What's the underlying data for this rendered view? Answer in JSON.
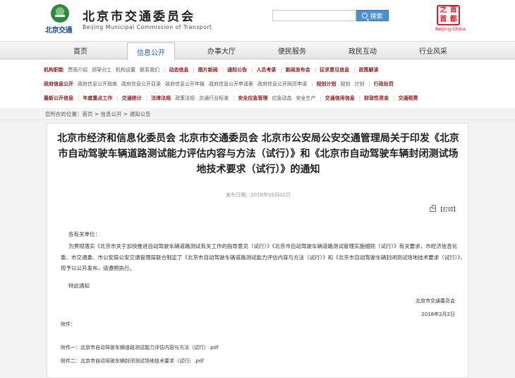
{
  "header": {
    "logo_sub": "北京交通",
    "title": "北京市交通委员会",
    "subtitle": "Beijing Municipal Commission of Transport",
    "search_placeholder": "",
    "search_button": "搜索",
    "seal_chars": [
      "之",
      "首",
      "首",
      "都"
    ],
    "seal_sub": "Beijing·China"
  },
  "mainnav": [
    {
      "label": "首页",
      "active": false
    },
    {
      "label": "信息公开",
      "active": true
    },
    {
      "label": "办事大厅",
      "active": false
    },
    {
      "label": "便民服务",
      "active": false
    },
    {
      "label": "政民互动",
      "active": false
    },
    {
      "label": "行业风采",
      "active": false
    }
  ],
  "subnav": {
    "row1": [
      {
        "t": "机构职能",
        "k": "sec"
      },
      {
        "t": "贾雨介绍",
        "k": "lnk"
      },
      {
        "t": "领导分工",
        "k": "lnk"
      },
      {
        "t": "机构设置",
        "k": "lnk"
      },
      {
        "t": "联系我们",
        "k": "lnk"
      },
      {
        "t": "|",
        "k": "sep"
      },
      {
        "t": "动态信息",
        "k": "sec"
      },
      {
        "t": "|",
        "k": "sep"
      },
      {
        "t": "图片新闻",
        "k": "sec"
      },
      {
        "t": "|",
        "k": "sep"
      },
      {
        "t": "通知公告",
        "k": "sec"
      },
      {
        "t": "|",
        "k": "sep"
      },
      {
        "t": "人员考录",
        "k": "sec"
      },
      {
        "t": "|",
        "k": "sep"
      },
      {
        "t": "新闻发布会",
        "k": "sec"
      },
      {
        "t": "|",
        "k": "sep"
      },
      {
        "t": "征求意见信息",
        "k": "sec"
      },
      {
        "t": "|",
        "k": "sep"
      },
      {
        "t": "政策解读",
        "k": "sec"
      }
    ],
    "row2": [
      {
        "t": "政府信息公开",
        "k": "sec"
      },
      {
        "t": "政府信息公开指南",
        "k": "lnk"
      },
      {
        "t": "政府信息公开目录",
        "k": "lnk"
      },
      {
        "t": "政府信息公开年报",
        "k": "lnk"
      },
      {
        "t": "政府信息公开申请表",
        "k": "lnk"
      },
      {
        "t": "政府信息公开网页申请",
        "k": "lnk"
      },
      {
        "t": "|",
        "k": "sep"
      },
      {
        "t": "规划计划",
        "k": "sec"
      },
      {
        "t": "规划",
        "k": "lnk"
      },
      {
        "t": "计划",
        "k": "lnk"
      },
      {
        "t": "|",
        "k": "sep"
      },
      {
        "t": "行政处罚",
        "k": "sec"
      }
    ],
    "row3": [
      {
        "t": "最新公开信息",
        "k": "sec"
      },
      {
        "t": "|",
        "k": "sep"
      },
      {
        "t": "年度重点工作",
        "k": "sec"
      },
      {
        "t": "|",
        "k": "sep"
      },
      {
        "t": "交通统计",
        "k": "sec"
      },
      {
        "t": "|",
        "k": "sep"
      },
      {
        "t": "法律法规",
        "k": "sec"
      },
      {
        "t": "政策法规",
        "k": "lnk"
      },
      {
        "t": "交通行业标准",
        "k": "lnk"
      },
      {
        "t": "|",
        "k": "sep"
      },
      {
        "t": "安全应急管理",
        "k": "sec"
      },
      {
        "t": "应急动态",
        "k": "lnk"
      },
      {
        "t": "安全生产",
        "k": "lnk"
      },
      {
        "t": "|",
        "k": "sep"
      },
      {
        "t": "交通信用信息",
        "k": "sec"
      },
      {
        "t": "|",
        "k": "sep"
      },
      {
        "t": "财政性资金",
        "k": "sec"
      },
      {
        "t": "|",
        "k": "sep"
      },
      {
        "t": "交通税费",
        "k": "sec"
      }
    ]
  },
  "breadcrumb": {
    "prefix": "您所在的位置：",
    "path": "首页 > 信息公开 > 通知公告"
  },
  "article": {
    "title": "北京市经济和信息化委员会 北京市交通委员会 北京市公安局公安交通管理局关于印发《北京市自动驾驶车辆道路测试能力评估内容与方法（试行）》和《北京市自动驾驶车辆封闭测试场地技术要求（试行）》的通知",
    "date": "发布日期：2018年02月02日",
    "print_label": "【打印】",
    "salutation": "各有关单位：",
    "paragraph": "为贯彻落实《北京市关于加快推进自动驾驶车辆道路测试有关工作的指导意见（试行）》《北京市自动驾驶车辆道路测试管理实施细则（试行）》有关要求，市经济信息化委、市交通委、市公安局公安交通管理局联合制定了《北京市自动驾驶车辆道路测试能力评估内容与方法（试行）》和《北京市自动驾驶车辆封闭测试场地技术要求（试行）》，现予以公开发布，请遵照执行。",
    "closing": "特此通知",
    "signature_org": "北京市交通委员会",
    "signature_date": "2018年2月2日",
    "attachments_label": "附件：",
    "attachments": [
      "附件一：北京市自动驾驶车辆道路测试能力评估内容与方法（试行）.pdf",
      "附件二：北京市自动驾驶车辆封闭测试场地技术要求（试行）.pdf"
    ]
  }
}
